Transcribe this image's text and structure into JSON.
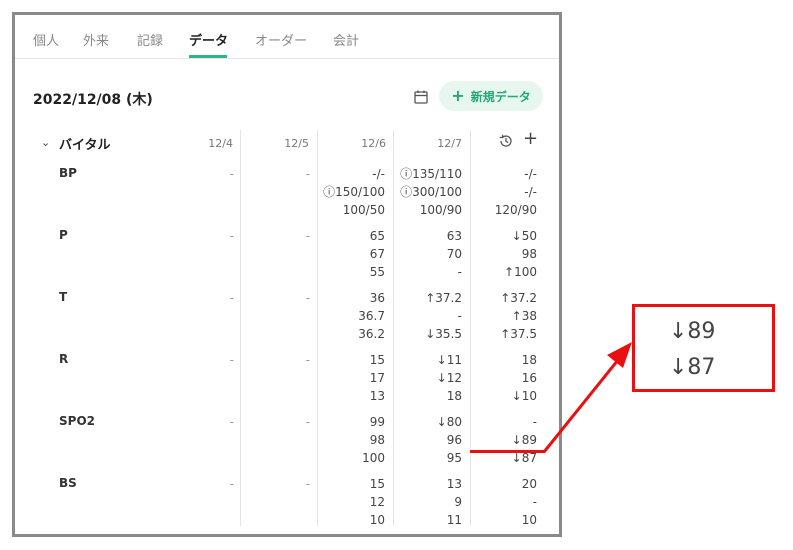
{
  "tabs": [
    "個人",
    "外来",
    "記録",
    "データ",
    "オーダー",
    "会計"
  ],
  "date": "2022/12/08 (木)",
  "new_button": "新規データ",
  "section": "バイタル",
  "columns": [
    "12/4",
    "12/5",
    "12/6",
    "12/7"
  ],
  "rows": [
    {
      "label": "BP",
      "c1": "-",
      "c2": "-",
      "c3": [
        "-/-",
        "ⓘ150/100",
        "100/50"
      ],
      "c4": [
        "ⓘ135/110",
        "ⓘ300/100",
        "100/90"
      ],
      "c5": [
        "-/-",
        "-/-",
        "120/90"
      ]
    },
    {
      "label": "P",
      "c1": "-",
      "c2": "-",
      "c3": [
        "65",
        "67",
        "55"
      ],
      "c4": [
        "63",
        "70",
        "-"
      ],
      "c5": [
        "↓50",
        "98",
        "↑100"
      ]
    },
    {
      "label": "T",
      "c1": "-",
      "c2": "-",
      "c3": [
        "36",
        "36.7",
        "36.2"
      ],
      "c4": [
        "↑37.2",
        "-",
        "↓35.5"
      ],
      "c5": [
        "↑37.2",
        "↑38",
        "↑37.5"
      ]
    },
    {
      "label": "R",
      "c1": "-",
      "c2": "-",
      "c3": [
        "15",
        "17",
        "13"
      ],
      "c4": [
        "↓11",
        "↓12",
        "18"
      ],
      "c5": [
        "18",
        "16",
        "↓10"
      ]
    },
    {
      "label": "SPO2",
      "c1": "-",
      "c2": "-",
      "c3": [
        "99",
        "98",
        "100"
      ],
      "c4": [
        "↓80",
        "96",
        "95"
      ],
      "c5": [
        "-",
        "↓89",
        "↓87"
      ]
    },
    {
      "label": "BS",
      "c1": "-",
      "c2": "-",
      "c3": [
        "15",
        "12",
        "10"
      ],
      "c4": [
        "13",
        "9",
        "11"
      ],
      "c5": [
        "20",
        "-",
        "10"
      ]
    }
  ],
  "zoom": [
    "↓89",
    "↓87"
  ],
  "colors": {
    "accent": "#2bb68a",
    "highlight": "#e81010"
  }
}
